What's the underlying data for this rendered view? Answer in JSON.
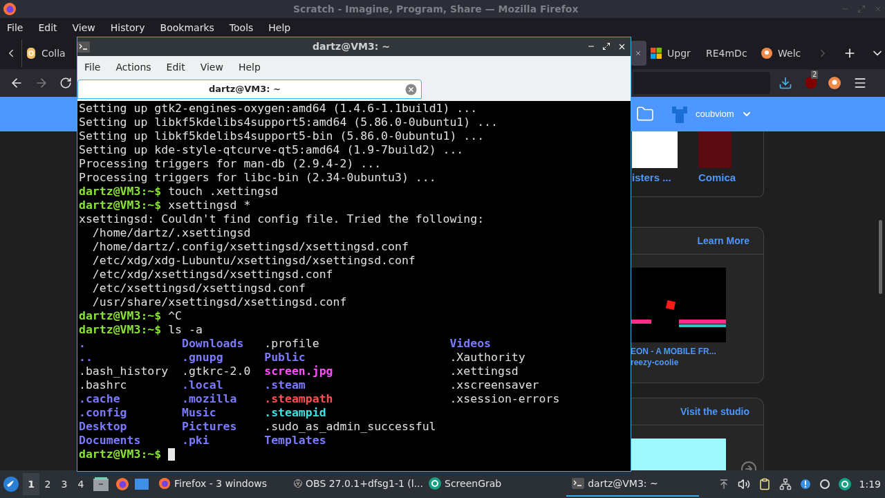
{
  "firefox": {
    "title": "Scratch - Imagine, Program, Share — Mozilla Firefox",
    "menu": [
      "File",
      "Edit",
      "View",
      "History",
      "Bookmarks",
      "Tools",
      "Help"
    ],
    "tabs": [
      {
        "label": "Colla",
        "selected": false
      },
      {
        "selected": true
      },
      {
        "label": "Upgr",
        "selected": false
      },
      {
        "label": "RE4mDc",
        "selected": false
      },
      {
        "label": "Welc",
        "selected": false
      }
    ],
    "extension_badge": "2",
    "header": {
      "username": "coubviom"
    },
    "cards": [
      {
        "kind": "gallery",
        "items": [
          {
            "title": "isters ..."
          },
          {
            "title": "Comica"
          }
        ]
      },
      {
        "kind": "project",
        "link": "Learn More",
        "title": "EON - A MOBILE FR...",
        "author": "reezy-coolie"
      },
      {
        "kind": "project",
        "link": "Visit the studio"
      }
    ]
  },
  "terminal": {
    "title": "dartz@VM3: ~",
    "menu": [
      "File",
      "Actions",
      "Edit",
      "View",
      "Help"
    ],
    "tab": "dartz@VM3: ~",
    "lines": [
      {
        "kind": "output",
        "text": "Setting up gtk2-engines-oxygen:amd64 (1.4.6-1.1build1) ..."
      },
      {
        "kind": "output",
        "text": "Setting up libkf5kdelibs4support5:amd64 (5.86.0-0ubuntu1) ..."
      },
      {
        "kind": "output",
        "text": "Setting up libkf5kdelibs4support5-bin (5.86.0-0ubuntu1) ..."
      },
      {
        "kind": "output",
        "text": "Setting up kde-style-qtcurve-qt5:amd64 (1.9-7build2) ..."
      },
      {
        "kind": "output",
        "text": "Processing triggers for man-db (2.9.4-2) ..."
      },
      {
        "kind": "output",
        "text": "Processing triggers for libc-bin (2.34-0ubuntu3) ..."
      },
      {
        "kind": "prompt",
        "prompt": "dartz@VM3:~$",
        "command": "touch .xettingsd"
      },
      {
        "kind": "prompt",
        "prompt": "dartz@VM3:~$",
        "command": "xsettingsd *"
      },
      {
        "kind": "output",
        "text": "xsettingsd: Couldn't find config file. Tried the following:"
      },
      {
        "kind": "output",
        "text": "  /home/dartz/.xsettingsd"
      },
      {
        "kind": "output",
        "text": "  /home/dartz/.config/xsettingsd/xsettingsd.conf"
      },
      {
        "kind": "output",
        "text": "  /etc/xdg/xdg-Lubuntu/xsettingsd/xsettingsd.conf"
      },
      {
        "kind": "output",
        "text": "  /etc/xdg/xsettingsd/xsettingsd.conf"
      },
      {
        "kind": "output",
        "text": "  /etc/xsettingsd/xsettingsd.conf"
      },
      {
        "kind": "output",
        "text": "  /usr/share/xsettingsd/xsettingsd.conf"
      },
      {
        "kind": "prompt",
        "prompt": "dartz@VM3:~$",
        "command": "^C"
      },
      {
        "kind": "prompt",
        "prompt": "dartz@VM3:~$",
        "command": "ls -a"
      },
      {
        "kind": "listing",
        "rows": [
          [
            {
              "name": ".",
              "kind": "dir"
            },
            {
              "name": "Downloads",
              "kind": "dir"
            },
            {
              "name": ".profile",
              "kind": "file"
            },
            {
              "name": "Videos",
              "kind": "dir"
            }
          ],
          [
            {
              "name": "..",
              "kind": "dir"
            },
            {
              "name": ".gnupg",
              "kind": "dir"
            },
            {
              "name": "Public",
              "kind": "dir"
            },
            {
              "name": ".Xauthority",
              "kind": "file"
            }
          ],
          [
            {
              "name": ".bash_history",
              "kind": "file"
            },
            {
              "name": ".gtkrc-2.0",
              "kind": "file"
            },
            {
              "name": "screen.jpg",
              "kind": "image"
            },
            {
              "name": ".xettingsd",
              "kind": "file"
            }
          ],
          [
            {
              "name": ".bashrc",
              "kind": "file"
            },
            {
              "name": ".local",
              "kind": "dir"
            },
            {
              "name": ".steam",
              "kind": "dir"
            },
            {
              "name": ".xscreensaver",
              "kind": "file"
            }
          ],
          [
            {
              "name": ".cache",
              "kind": "dir"
            },
            {
              "name": ".mozilla",
              "kind": "dir"
            },
            {
              "name": ".steampath",
              "kind": "broken"
            },
            {
              "name": ".xsession-errors",
              "kind": "file"
            }
          ],
          [
            {
              "name": ".config",
              "kind": "dir"
            },
            {
              "name": "Music",
              "kind": "dir"
            },
            {
              "name": ".steampid",
              "kind": "link"
            }
          ],
          [
            {
              "name": "Desktop",
              "kind": "dir"
            },
            {
              "name": "Pictures",
              "kind": "dir"
            },
            {
              "name": ".sudo_as_admin_successful",
              "kind": "file"
            }
          ],
          [
            {
              "name": "Documents",
              "kind": "dir"
            },
            {
              "name": ".pki",
              "kind": "dir"
            },
            {
              "name": "Templates",
              "kind": "dir"
            }
          ]
        ]
      },
      {
        "kind": "prompt",
        "prompt": "dartz@VM3:~$",
        "cursor": true
      }
    ]
  },
  "taskbar": {
    "workspaces": [
      {
        "label": "1",
        "selected": true
      },
      {
        "label": "2",
        "selected": false
      },
      {
        "label": "3",
        "selected": false
      },
      {
        "label": "4",
        "selected": false
      }
    ],
    "windows": [
      {
        "label": "Firefox - 3 windows",
        "selected": false
      },
      {
        "label": "OBS 27.0.1+dfsg1-1 (l...",
        "selected": false
      },
      {
        "label": "ScreenGrab",
        "selected": false
      },
      {
        "label": "dartz@VM3: ~",
        "selected": true
      }
    ],
    "clock": "1:19"
  }
}
